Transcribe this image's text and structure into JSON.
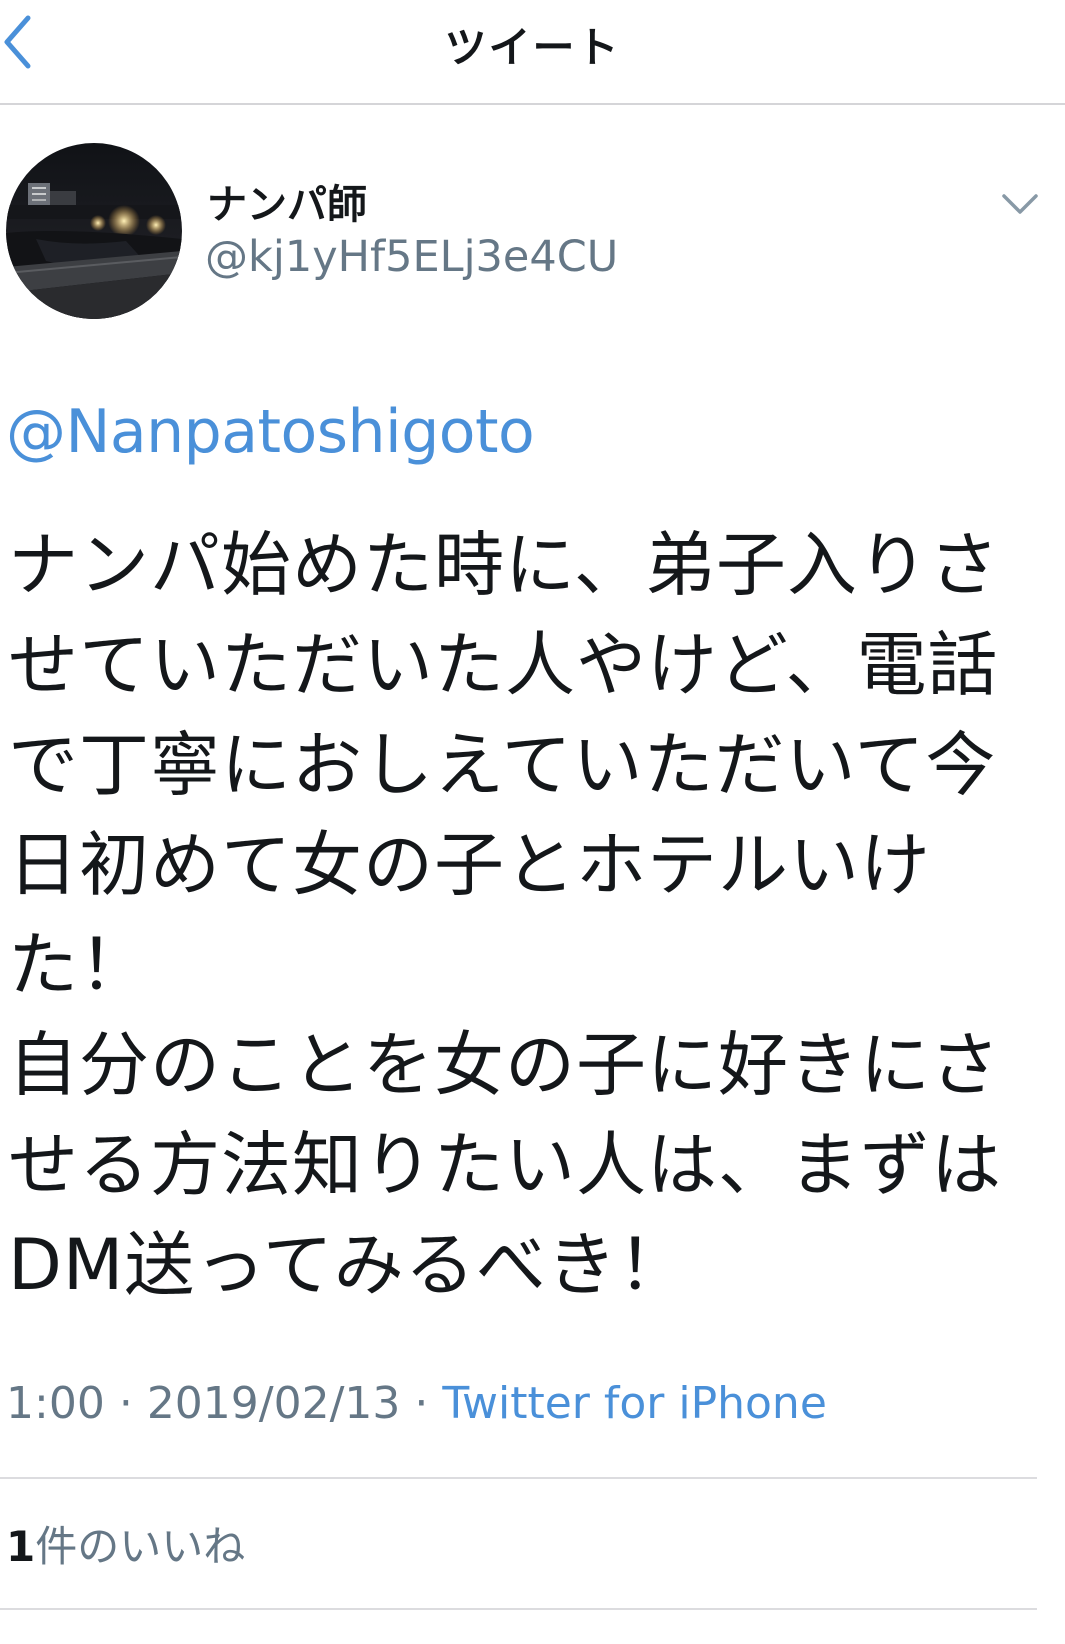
{
  "nav": {
    "title": "ツイート",
    "back_icon": "chevron-left-icon"
  },
  "tweet": {
    "author": {
      "display_name": "ナンパ師",
      "handle": "@kj1yHf5ELj3e4CU",
      "avatar_description": "night-river-photo"
    },
    "reply_to": "@Nanpatoshigoto",
    "text_lines": [
      "ナンパ始めた時に、弟子入りさ",
      "せていただいた人やけど、電話",
      "で丁寧におしえていただいて今",
      "日初めて女の子とホテルいけ",
      "た！",
      "自分のことを女の子に好きにさ",
      "せる方法知りたい人は、まずは",
      "DM送ってみるべき！"
    ],
    "time": "1:00",
    "date": "2019/02/13",
    "separator": "·",
    "source": "Twitter for iPhone",
    "likes_count": "1",
    "likes_label": "件のいいね"
  },
  "colors": {
    "link": "#4a90d9",
    "text": "#14171a",
    "muted": "#657786",
    "divider": "#dcdcdf"
  }
}
